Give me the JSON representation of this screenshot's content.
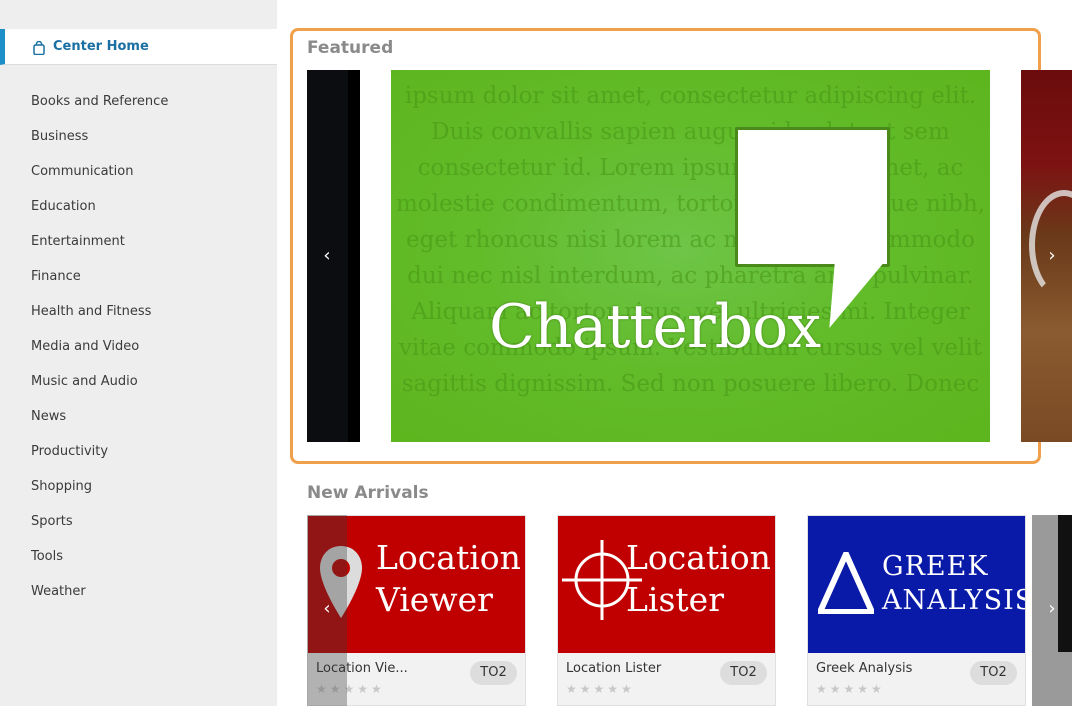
{
  "sidebar": {
    "home_label": "Center Home",
    "categories": [
      "Books and Reference",
      "Business",
      "Communication",
      "Education",
      "Entertainment",
      "Finance",
      "Health and Fitness",
      "Media and Video",
      "Music and Audio",
      "News",
      "Productivity",
      "Shopping",
      "Sports",
      "Tools",
      "Weather"
    ]
  },
  "featured": {
    "title": "Featured",
    "banner_title": "Chatterbox",
    "banner_background_text": "ipsum dolor sit amet, consectetur adipiscing elit. Duis convallis sapien augue, id volutpat sem consectetur id. Lorem ipsum dolor sit amet, ac molestie condimentum, tortor lacus tristique nibh, eget rhoncus nisi lorem ac massa. Sed commodo dui nec nisl interdum, ac pharetra ante pulvinar. Aliquam ac tortor risus, vel ultricies mi. Integer vitae commodo ipsum. Vestibulum cursus vel velit sagittis dignissim. Sed non posuere libero. Donec",
    "prev_icon": "chevron-left-icon",
    "next_icon": "chevron-right-icon"
  },
  "new_arrivals": {
    "title": "New Arrivals",
    "cards": [
      {
        "thumb_line1": "Location",
        "thumb_line2": "Viewer",
        "name": "Location Vie...",
        "badge": "TO2",
        "color": "#c00000"
      },
      {
        "thumb_line1": "Location",
        "thumb_line2": "Lister",
        "name": "Location Lister",
        "badge": "TO2",
        "color": "#c00000"
      },
      {
        "thumb_line1": "Greek",
        "thumb_line2": "Analysis",
        "name": "Greek Analysis",
        "badge": "TO2",
        "color": "#0a1aa8"
      }
    ],
    "stars_empty": "★★★★★"
  },
  "colors": {
    "accent": "#1e8fc6",
    "featured_border": "#f0a04b"
  }
}
